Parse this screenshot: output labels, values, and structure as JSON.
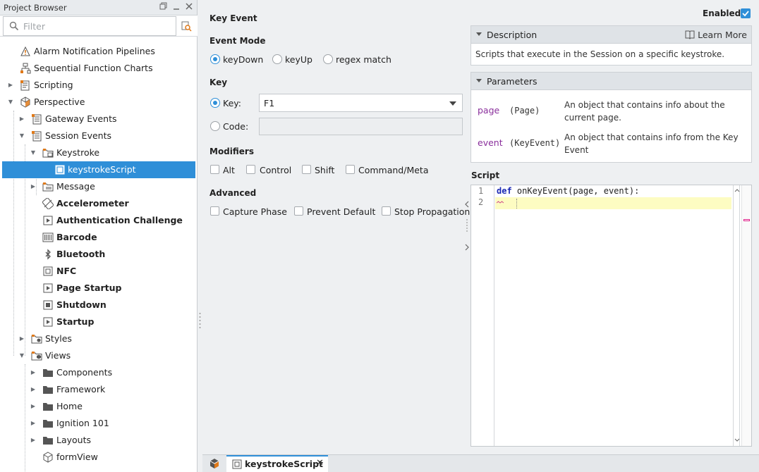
{
  "project_browser": {
    "title": "Project Browser",
    "filter_placeholder": "Filter",
    "tree": [
      {
        "label": "Alarm Notification Pipelines",
        "bold": false
      },
      {
        "label": "Sequential Function Charts",
        "bold": false
      },
      {
        "label": "Scripting",
        "bold": false
      },
      {
        "label": "Perspective",
        "bold": false
      },
      {
        "label": "Gateway Events",
        "bold": false
      },
      {
        "label": "Session Events",
        "bold": false
      },
      {
        "label": "Keystroke",
        "bold": false
      },
      {
        "label": "keystrokeScript",
        "bold": false,
        "selected": true
      },
      {
        "label": "Message",
        "bold": false
      },
      {
        "label": "Accelerometer",
        "bold": true
      },
      {
        "label": "Authentication Challenge",
        "bold": true
      },
      {
        "label": "Barcode",
        "bold": true
      },
      {
        "label": "Bluetooth",
        "bold": true
      },
      {
        "label": "NFC",
        "bold": true
      },
      {
        "label": "Page Startup",
        "bold": true
      },
      {
        "label": "Shutdown",
        "bold": true
      },
      {
        "label": "Startup",
        "bold": true
      },
      {
        "label": "Styles",
        "bold": false
      },
      {
        "label": "Views",
        "bold": false
      },
      {
        "label": "Components",
        "bold": false
      },
      {
        "label": "Framework",
        "bold": false
      },
      {
        "label": "Home",
        "bold": false
      },
      {
        "label": "Ignition 101",
        "bold": false
      },
      {
        "label": "Layouts",
        "bold": false
      },
      {
        "label": "formView",
        "bold": false
      }
    ]
  },
  "editor": {
    "title": "Key Event",
    "enabled_label": "Enabled",
    "enabled": true,
    "event_mode": {
      "label": "Event Mode",
      "options": [
        "keyDown",
        "keyUp",
        "regex match"
      ],
      "selected": "keyDown"
    },
    "key": {
      "label": "Key",
      "key_option": "Key:",
      "code_option": "Code:",
      "selected": "Key:",
      "key_value": "F1",
      "code_value": ""
    },
    "modifiers": {
      "label": "Modifiers",
      "options": [
        "Alt",
        "Control",
        "Shift",
        "Command/Meta"
      ]
    },
    "advanced": {
      "label": "Advanced",
      "options": [
        "Capture Phase",
        "Prevent Default",
        "Stop Propagation"
      ]
    },
    "description": {
      "title": "Description",
      "learn_more": "Learn More",
      "text": "Scripts that execute in the Session on a specific keystroke."
    },
    "parameters": {
      "title": "Parameters",
      "items": [
        {
          "name": "page",
          "type": "(Page)",
          "desc": "An object that contains info about the current page."
        },
        {
          "name": "event",
          "type": "(KeyEvent)",
          "desc": "An object that contains info from the Key Event"
        }
      ]
    },
    "script": {
      "label": "Script",
      "line_numbers": [
        "1",
        "2"
      ],
      "keyword": "def",
      "line1_rest": " onKeyEvent(page, event):"
    }
  },
  "tabs": {
    "active_label": "keystrokeScript"
  },
  "colors": {
    "accent": "#2f8fd8",
    "param_name": "#8a2f9c",
    "keyword": "#1a28b4",
    "current_line": "#fdfcc2"
  }
}
